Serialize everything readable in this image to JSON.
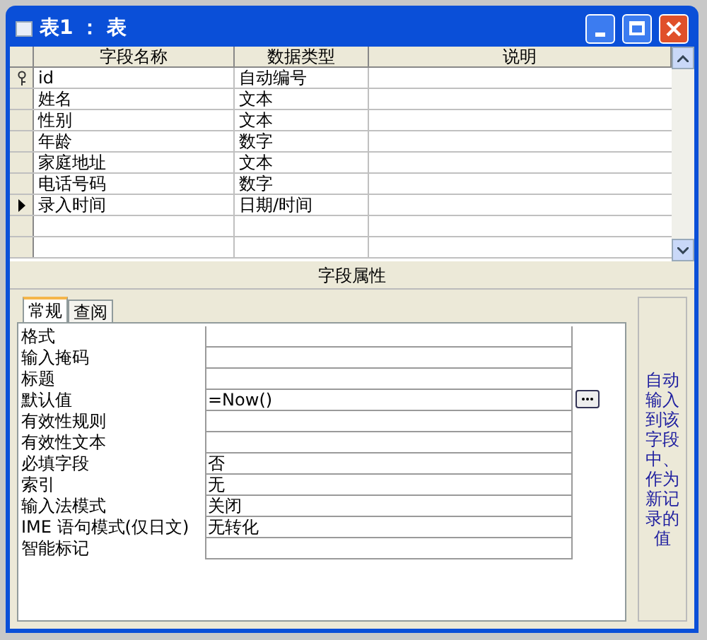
{
  "window": {
    "title": "表1 ： 表"
  },
  "grid": {
    "columns": [
      "字段名称",
      "数据类型",
      "说明"
    ],
    "rows": [
      {
        "name": "id",
        "type": "自动编号",
        "primary_key": true,
        "selected": false
      },
      {
        "name": "姓名",
        "type": "文本",
        "primary_key": false,
        "selected": false
      },
      {
        "name": "性别",
        "type": "文本",
        "primary_key": false,
        "selected": false
      },
      {
        "name": "年龄",
        "type": "数字",
        "primary_key": false,
        "selected": false
      },
      {
        "name": "家庭地址",
        "type": "文本",
        "primary_key": false,
        "selected": false
      },
      {
        "name": "电话号码",
        "type": "数字",
        "primary_key": false,
        "selected": false
      },
      {
        "name": "录入时间",
        "type": "日期/时间",
        "primary_key": false,
        "selected": true
      }
    ]
  },
  "field_properties": {
    "title": "字段属性",
    "tabs": [
      {
        "label": "常规",
        "selected": true
      },
      {
        "label": "查阅",
        "selected": false
      }
    ],
    "properties": [
      {
        "label": "格式"
      },
      {
        "label": "输入掩码"
      },
      {
        "label": "标题"
      },
      {
        "label": "默认值",
        "value": "=Now()",
        "builder": true
      },
      {
        "label": "有效性规则"
      },
      {
        "label": "有效性文本"
      },
      {
        "label": "必填字段",
        "value": "否"
      },
      {
        "label": "索引",
        "value": "无"
      },
      {
        "label": "输入法模式",
        "value": "关闭"
      },
      {
        "label": "IME 语句模式(仅日文)",
        "value": "无转化"
      },
      {
        "label": "智能标记"
      }
    ],
    "help_text": "自动输入到该字段中、作为新记录的值"
  }
}
